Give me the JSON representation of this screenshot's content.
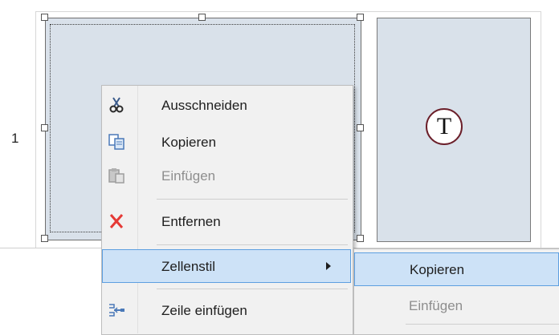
{
  "row": {
    "number": "1"
  },
  "cell": {
    "icon_letter": "T"
  },
  "context_menu": {
    "items": [
      {
        "label": "Ausschneiden",
        "icon": "scissors-icon",
        "enabled": true
      },
      {
        "label": "Kopieren",
        "icon": "copy-icon",
        "enabled": true
      },
      {
        "label": "Einfügen",
        "icon": "paste-icon",
        "enabled": false
      },
      {
        "label": "Entfernen",
        "icon": "delete-x-icon",
        "enabled": true
      },
      {
        "label": "Zellenstil",
        "icon": "",
        "enabled": true,
        "has_submenu": true,
        "highlighted": true
      },
      {
        "label": "Zeile einfügen",
        "icon": "insert-row-icon",
        "enabled": true
      }
    ]
  },
  "submenu": {
    "items": [
      {
        "label": "Kopieren",
        "enabled": true,
        "highlighted": true
      },
      {
        "label": "Einfügen",
        "enabled": false
      }
    ]
  },
  "colors": {
    "cell_fill": "#d9e1ea",
    "highlight_fill": "#cde2f7",
    "highlight_border": "#5d9fe0",
    "delete_red": "#e53935"
  }
}
